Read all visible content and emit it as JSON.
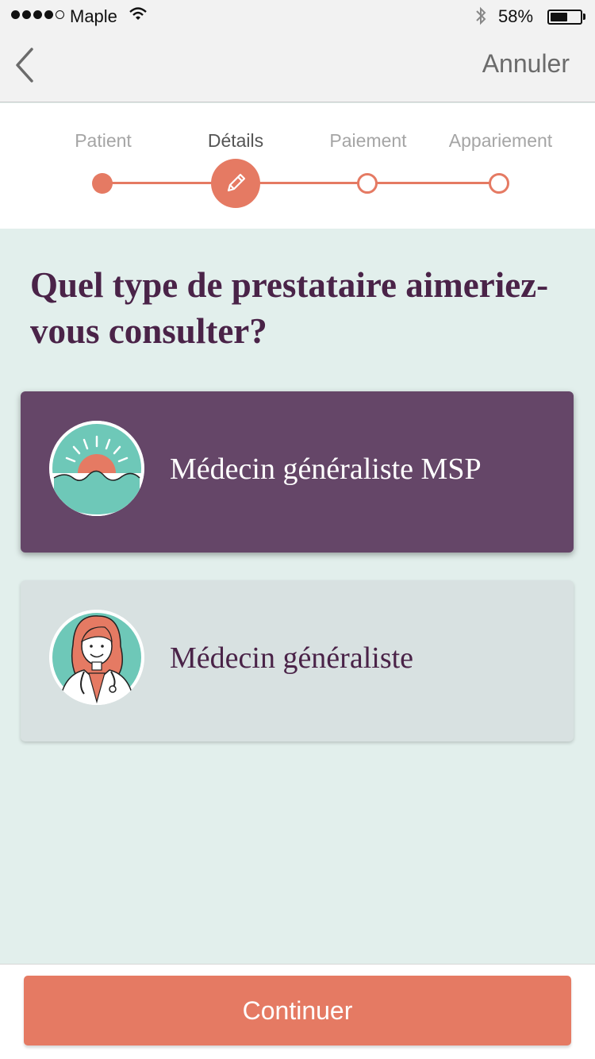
{
  "status_bar": {
    "carrier": "Maple",
    "battery_percent": "58%",
    "battery_level": 0.58,
    "signal_bars_filled": 4,
    "signal_bars_total": 5
  },
  "nav": {
    "cancel_label": "Annuler",
    "back_icon": "chevron-left-icon"
  },
  "stepper": {
    "steps": [
      {
        "label": "Patient",
        "state": "done"
      },
      {
        "label": "Détails",
        "state": "current"
      },
      {
        "label": "Paiement",
        "state": "todo"
      },
      {
        "label": "Appariement",
        "state": "todo"
      }
    ],
    "current_icon": "pencil-icon"
  },
  "question": "Quel type de prestataire aimeriez-vous consulter?",
  "options": [
    {
      "label": "Médecin généraliste MSP",
      "selected": true,
      "icon": "sunrise-icon"
    },
    {
      "label": "Médecin généraliste",
      "selected": false,
      "icon": "doctor-icon"
    }
  ],
  "footer": {
    "continue_label": "Continuer"
  },
  "colors": {
    "accent": "#e57a63",
    "selected_card": "#654668",
    "plain_card": "#d8e1e1",
    "background": "#e2efec",
    "heading": "#4a2348"
  }
}
